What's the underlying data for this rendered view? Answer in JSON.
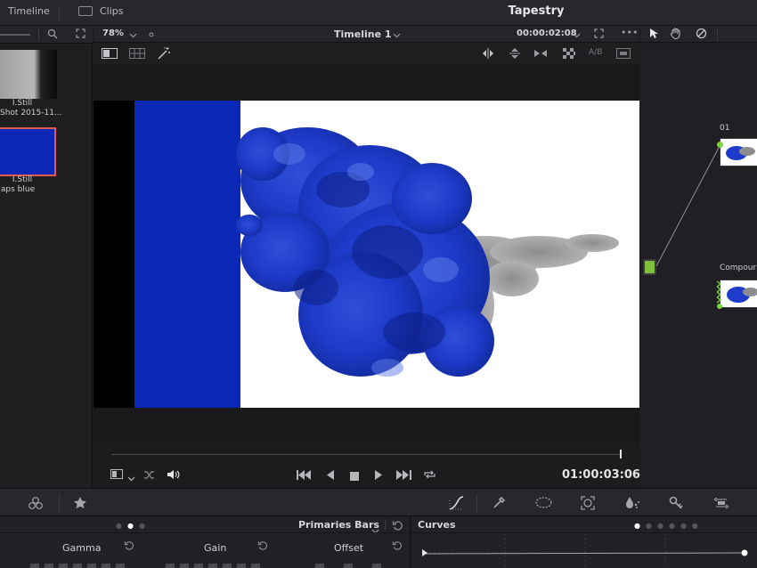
{
  "topbar": {
    "timeline_tab": "Timeline",
    "clips_tab": "Clips",
    "project_title": "Tapestry"
  },
  "gallery": {
    "stills": [
      {
        "type_label": "I.Still",
        "name": "Shot 2015-11..."
      },
      {
        "type_label": "I.Still",
        "name": "aps blue"
      }
    ],
    "selected_border_color": "#e05a4d"
  },
  "viewer": {
    "zoom": "78%",
    "timeline_name": "Timeline 1",
    "source_timecode": "00:00:02:08",
    "wipe_label": "A/B",
    "playhead_timecode": "01:00:03:06",
    "frame_colors": {
      "left_bar": "#000000",
      "blue_bar": "#0c28b6",
      "background": "#ffffff"
    }
  },
  "nodes": {
    "node1_label": "01",
    "node2_label": "Compour",
    "accent_green": "#7ad63a"
  },
  "color_toolbar": {
    "icons": [
      "color-wheels-icon",
      "favorites-star-icon",
      "curves-icon",
      "qualifier-eyedropper-icon",
      "window-circle-icon",
      "tracker-icon",
      "blur-icon",
      "key-icon",
      "sizing-icon"
    ]
  },
  "primaries": {
    "title": "Primaries Bars",
    "labels": [
      "Gamma",
      "Gain",
      "Offset"
    ]
  },
  "curves": {
    "title": "Curves"
  }
}
